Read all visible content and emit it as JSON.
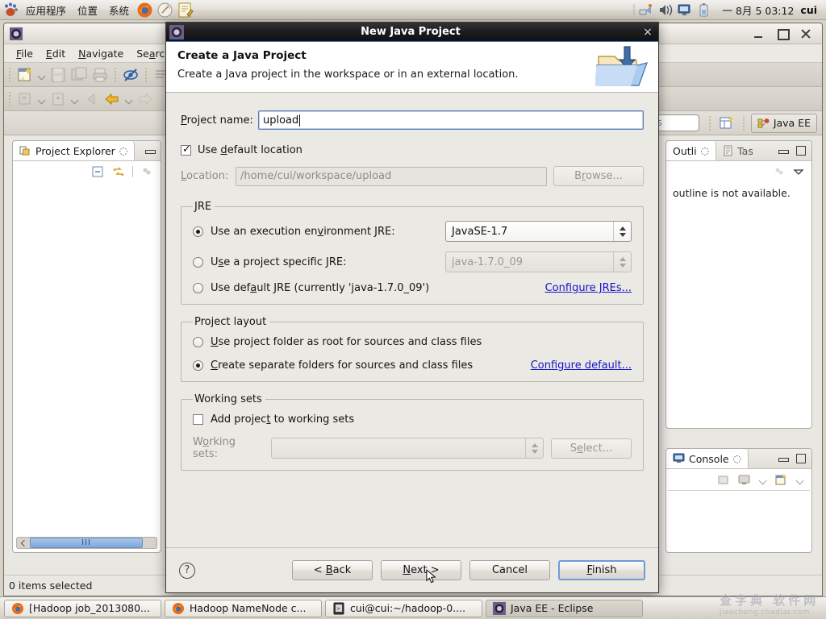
{
  "gnome_panel": {
    "menus": [
      "应用程序",
      "位置",
      "系统"
    ],
    "launcher_icons": [
      "firefox-icon",
      "help-icon",
      "text-editor-icon"
    ],
    "tray_icons": [
      "network-icon",
      "volume-icon",
      "display-icon",
      "battery-icon"
    ],
    "clock": "一 8月  5 03:12",
    "user": "cui"
  },
  "eclipse": {
    "window_title": "Java EE - Eclipse",
    "app_icon": "eclipse-icon",
    "menus": [
      {
        "label": "File",
        "mnemonic": "F"
      },
      {
        "label": "Edit",
        "mnemonic": "E"
      },
      {
        "label": "Navigate",
        "mnemonic": "N"
      },
      {
        "label": "Search",
        "mnemonic": "a"
      }
    ],
    "window_buttons": [
      "minimize",
      "maximize",
      "close"
    ],
    "perspective": {
      "search_placeholder": "ess",
      "button_label": "Java EE",
      "new_perspective_icon": "new-perspective-icon"
    },
    "project_explorer": {
      "tab_label": "Project Explorer",
      "close_icon": "close-icon",
      "collapse_all_icon": "collapse-all-icon",
      "link_editor_icon": "link-with-editor-icon",
      "scroll_thumb_label": "III"
    },
    "outline_view": {
      "tab_label": "Outli",
      "tab2_label": "Tas",
      "message": "outline is not available.",
      "minimize_icon": "minimize-icon",
      "maximize_icon": "maximize-icon",
      "menu_icon": "view-menu-icon"
    },
    "console_view": {
      "tab_label": "Console",
      "close_icon": "close-icon",
      "minimize_icon": "minimize-icon",
      "maximize_icon": "maximize-icon",
      "toolbar_icons": [
        "clear-console-icon",
        "display-console-icon",
        "open-console-icon"
      ]
    },
    "status_bar": {
      "text": "0 items selected"
    }
  },
  "dialog": {
    "title": "New Java Project",
    "title_icon": "eclipse-icon",
    "close_label": "×",
    "header": {
      "heading": "Create a Java Project",
      "subheading": "Create a Java project in the workspace or in an external location.",
      "icon": "new-java-project-folder-icon"
    },
    "project_name": {
      "label": "Project name:",
      "mnemonic_pre": "P",
      "mnemonic_post": "roject name:",
      "value": "upload"
    },
    "use_default_location": {
      "label_pre": "Use ",
      "mnemonic": "d",
      "label_post": "efault location",
      "checked": true
    },
    "location": {
      "label_pre": "L",
      "mnemonic": "",
      "label": "Location:",
      "value": "/home/cui/workspace/upload",
      "browse_label_pre": "B",
      "browse_mnemonic": "r",
      "browse_label": "Browse...",
      "enabled": false
    },
    "jre": {
      "legend": "JRE",
      "options": [
        {
          "label_pre": "Use an execution en",
          "mnemonic": "v",
          "label_post": "ironment JRE:",
          "full_label": "Use an execution environment JRE:",
          "selected": true,
          "combo_value": "JavaSE-1.7",
          "combo_enabled": true
        },
        {
          "label_pre": "U",
          "mnemonic": "se",
          "label_post": " a project specific JRE:",
          "full_label": "Use a project specific JRE:",
          "selected": false,
          "combo_value": "java-1.7.0_09",
          "combo_enabled": false
        },
        {
          "label_pre": "Use def",
          "mnemonic": "a",
          "label_post": "ult JRE (currently 'java-1.7.0_09')",
          "full_label": "Use default JRE (currently 'java-1.7.0_09')",
          "selected": false
        }
      ],
      "configure_link": "Configure JREs..."
    },
    "project_layout": {
      "legend": "Project layout",
      "options": [
        {
          "label_pre": "",
          "mnemonic": "U",
          "label_post": "se project folder as root for sources and class files",
          "full_label": "Use project folder as root for sources and class files",
          "selected": false
        },
        {
          "label_pre": "",
          "mnemonic": "C",
          "label_post": "reate separate folders for sources and class files",
          "full_label": "Create separate folders for sources and class files",
          "selected": true
        }
      ],
      "configure_link": "Configure default..."
    },
    "working_sets": {
      "legend": "Working sets",
      "checkbox": {
        "label_pre": "Add projec",
        "mnemonic": "t",
        "label_post": " to working sets",
        "full_label": "Add project to working sets",
        "checked": false
      },
      "combo_label_pre": "W",
      "combo_mnemonic": "o",
      "combo_label_post": "rking sets:",
      "combo_label": "Working sets:",
      "combo_value": "",
      "select_label_pre": "S",
      "select_mnemonic": "e",
      "select_label_post": "lect...",
      "select_label": "Select..."
    },
    "footer": {
      "help_icon": "help-icon",
      "back": {
        "pre": "< ",
        "mnemonic": "B",
        "post": "ack",
        "full": "< Back"
      },
      "next": {
        "pre": "",
        "mnemonic": "N",
        "post": "ext >",
        "full": "Next >"
      },
      "cancel": {
        "pre": "Cancel",
        "mnemonic": "",
        "post": "",
        "full": "Cancel"
      },
      "finish": {
        "pre": "",
        "mnemonic": "F",
        "post": "inish",
        "full": "Finish"
      }
    }
  },
  "taskbar": {
    "windows": [
      {
        "label": "[Hadoop job_2013080...",
        "icon": "firefox-icon",
        "active": false
      },
      {
        "label": "Hadoop NameNode c...",
        "icon": "firefox-icon",
        "active": false
      },
      {
        "label": "cui@cui:~/hadoop-0....",
        "icon": "terminal-icon",
        "active": false
      },
      {
        "label": "Java EE - Eclipse",
        "icon": "eclipse-icon",
        "active": true
      }
    ]
  },
  "watermark": {
    "line1": "查字典 软件网",
    "line2": "jiaocheng.chadiar.com"
  }
}
